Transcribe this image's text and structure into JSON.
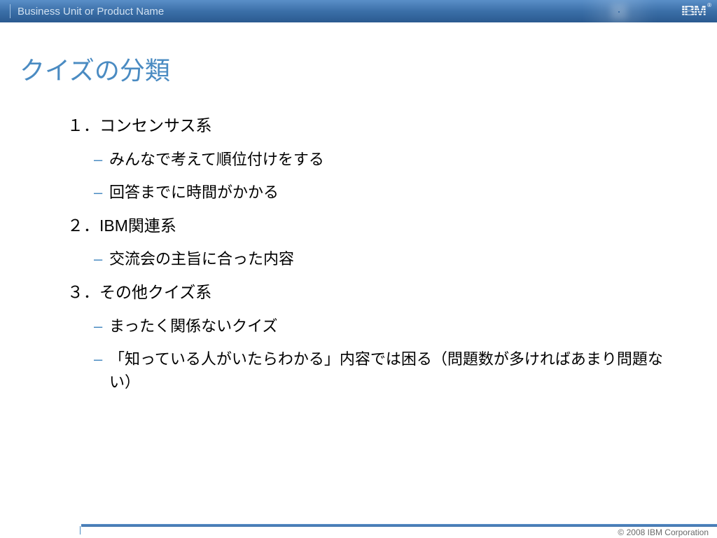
{
  "header": {
    "unit_label": "Business Unit or Product Name",
    "logo_text": "IBM",
    "registered": "®"
  },
  "slide": {
    "title": "クイズの分類",
    "sections": [
      {
        "heading": "１．コンセンサス系",
        "items": [
          "みんなで考えて順位付けをする",
          "回答までに時間がかかる"
        ]
      },
      {
        "heading": "２．IBM関連系",
        "items": [
          "交流会の主旨に合った内容"
        ]
      },
      {
        "heading": "３．その他クイズ系",
        "items": [
          "まったく関係ないクイズ",
          "「知っている人がいたらわかる」内容では困る（問題数が多ければあまり問題ない）"
        ]
      }
    ]
  },
  "footer": {
    "copyright": "© 2008 IBM Corporation"
  }
}
